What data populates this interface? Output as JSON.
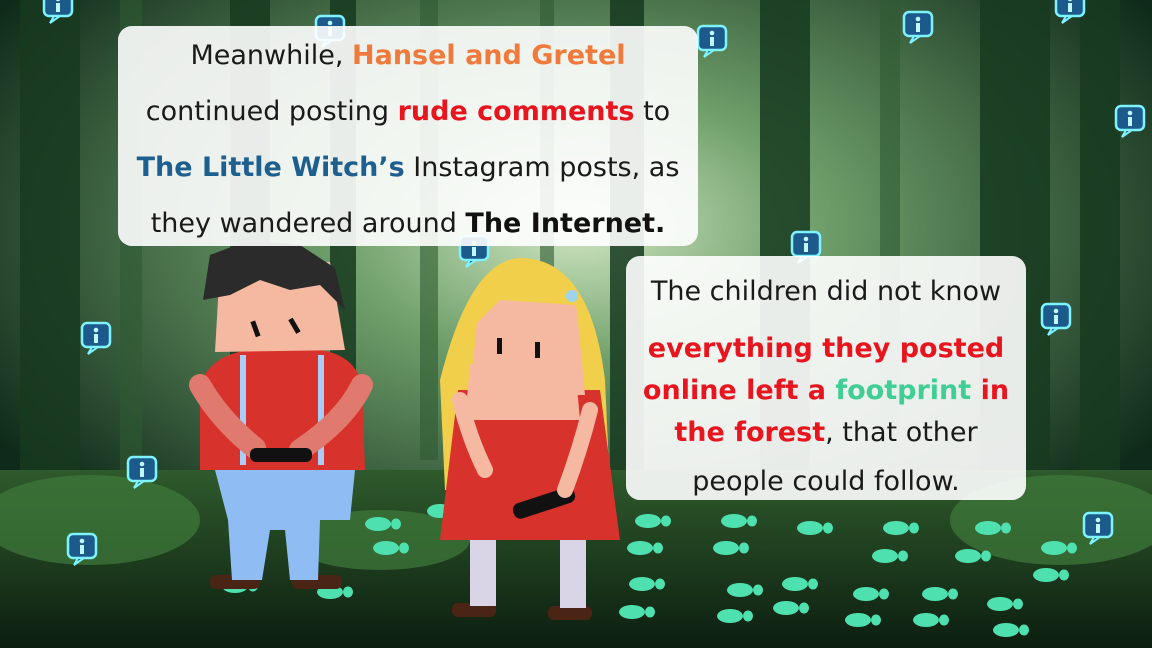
{
  "colors": {
    "forest_dark": "#0f2a1a",
    "forest_light": "#6fa26a",
    "footprint": "#4fe0b0",
    "accent_orange": "#f07a3c",
    "accent_red": "#e8141e",
    "accent_blue": "#1d5f8f",
    "accent_green": "#3fcf95"
  },
  "icons": [
    "info-bubble-icon",
    "footprint-icon",
    "smartphone-icon"
  ],
  "bubble1": {
    "l1_pre": "Meanwhile, ",
    "l1_hl": "Hansel and Gretel",
    "l2_pre": "continued posting ",
    "l2_hl": "rude comments",
    "l2_post": " to",
    "l3_hl": "The Little Witch’s",
    "l3_post": " Instagram posts, as",
    "l4_pre": "they wandered around ",
    "l4_hl": "The Internet."
  },
  "bubble2": {
    "l1": "The children did not know",
    "l2": "everything they posted",
    "l3_a": "online left a ",
    "l3_b": "footprint",
    "l3_c": " in",
    "l4_a": "the forest",
    "l4_b": ", that other",
    "l5": "people could follow."
  }
}
